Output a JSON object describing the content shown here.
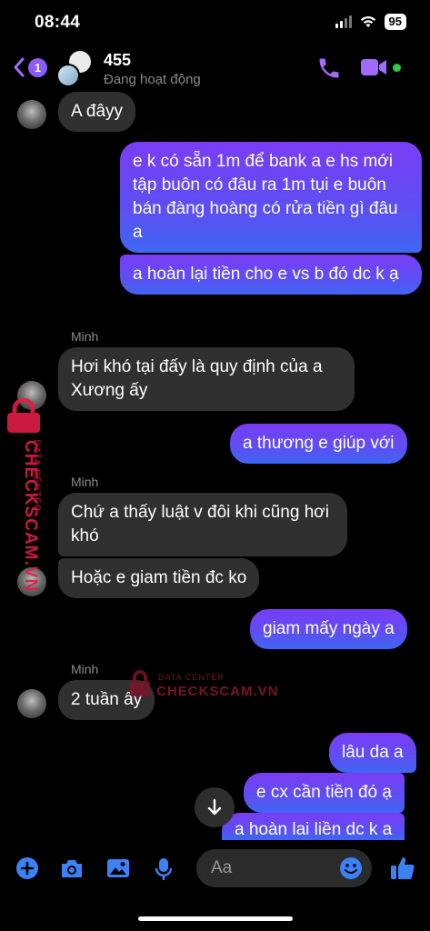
{
  "status_bar": {
    "time": "08:44",
    "battery": "95"
  },
  "header": {
    "back_badge": "1",
    "name": "455",
    "status": "Đang hoạt động"
  },
  "messages": [
    {
      "dir": "in",
      "text": "A đâyy"
    },
    {
      "dir": "out",
      "text": "e k có sẵn 1m để bank a e hs mới tập buôn có đâu ra 1m tụi e buôn bán đàng hoàng có rửa tiền gì đâu a"
    },
    {
      "dir": "out",
      "text": "a hoàn lại tiền cho e vs b đó dc k ạ"
    },
    {
      "dir": "in",
      "sender": "Minh",
      "text": "Hơi khó tại đấy là quy định của a Xương ấy"
    },
    {
      "dir": "out",
      "text": "a thương e giúp với"
    },
    {
      "dir": "in",
      "sender": "Minh",
      "text": "Chứ a thấy luật v đôi khi cũng hơi khó"
    },
    {
      "dir": "in",
      "text": "Hoặc e giam tiền đc ko"
    },
    {
      "dir": "out",
      "text": "giam mấy ngày a"
    },
    {
      "dir": "in",
      "sender": "Minh",
      "text": "2 tuần ấy"
    },
    {
      "dir": "out",
      "text": "lâu da a"
    },
    {
      "dir": "out",
      "text": "e cx cần tiền đó ạ"
    },
    {
      "dir": "out",
      "text": "a hoàn lai liền dc k a"
    }
  ],
  "watermark": {
    "brand": "CHECKSCAM.VN",
    "sub": "DATA CENTER"
  },
  "composer": {
    "placeholder": "Aa"
  },
  "colors": {
    "accent": "#a26bff",
    "online": "#31cc46",
    "incoming": "#303030"
  }
}
